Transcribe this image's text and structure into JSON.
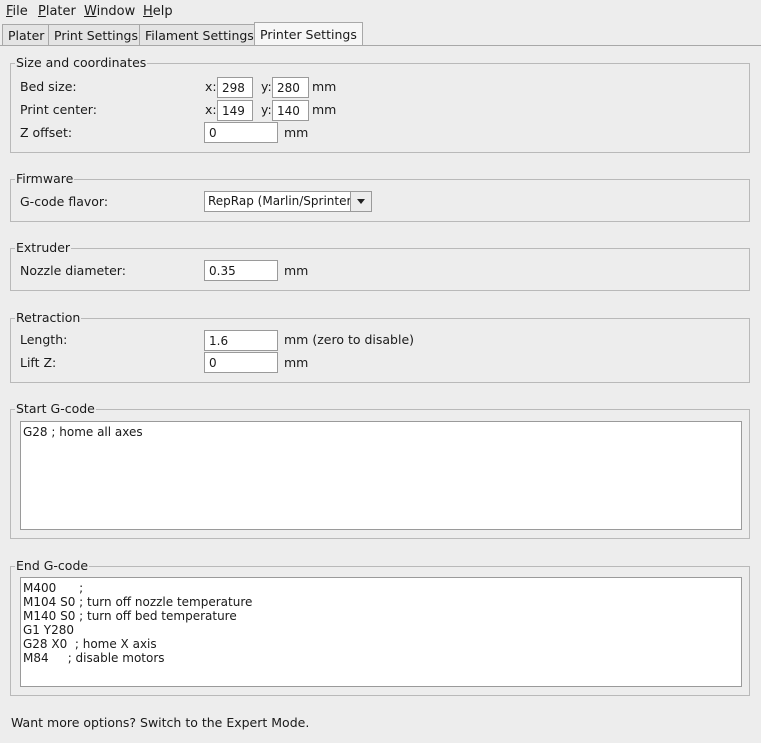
{
  "menu": {
    "file": {
      "u": "F",
      "rest": "ile"
    },
    "plater": {
      "u": "P",
      "rest": "later"
    },
    "window": {
      "u": "W",
      "rest": "indow"
    },
    "help": {
      "u": "H",
      "rest": "elp"
    }
  },
  "tabs": [
    "Plater",
    "Print Settings",
    "Filament Settings",
    "Printer Settings"
  ],
  "size": {
    "title": "Size and coordinates",
    "bed_label": "Bed size:",
    "bed_x": "298",
    "bed_y": "280",
    "center_label": "Print center:",
    "center_x": "149",
    "center_y": "140",
    "z_label": "Z offset:",
    "z_value": "0",
    "x_prefix": "x:",
    "y_prefix": "y:",
    "unit": "mm"
  },
  "firmware": {
    "title": "Firmware",
    "flavor_label": "G-code flavor:",
    "flavor_value": "RepRap (Marlin/Sprinter)"
  },
  "extruder": {
    "title": "Extruder",
    "nozzle_label": "Nozzle diameter:",
    "nozzle_value": "0.35",
    "unit": "mm"
  },
  "retraction": {
    "title": "Retraction",
    "length_label": "Length:",
    "length_value": "1.6",
    "length_unit": "mm (zero to disable)",
    "lift_label": "Lift Z:",
    "lift_value": "0",
    "lift_unit": "mm"
  },
  "start_gcode": {
    "title": "Start G-code",
    "text": "G28 ; home all axes"
  },
  "end_gcode": {
    "title": "End G-code",
    "text": "M400      ;\nM104 S0 ; turn off nozzle temperature\nM140 S0 ; turn off bed temperature\nG1 Y280\nG28 X0  ; home X axis\nM84     ; disable motors"
  },
  "footer": "Want more options? Switch to the Expert Mode."
}
